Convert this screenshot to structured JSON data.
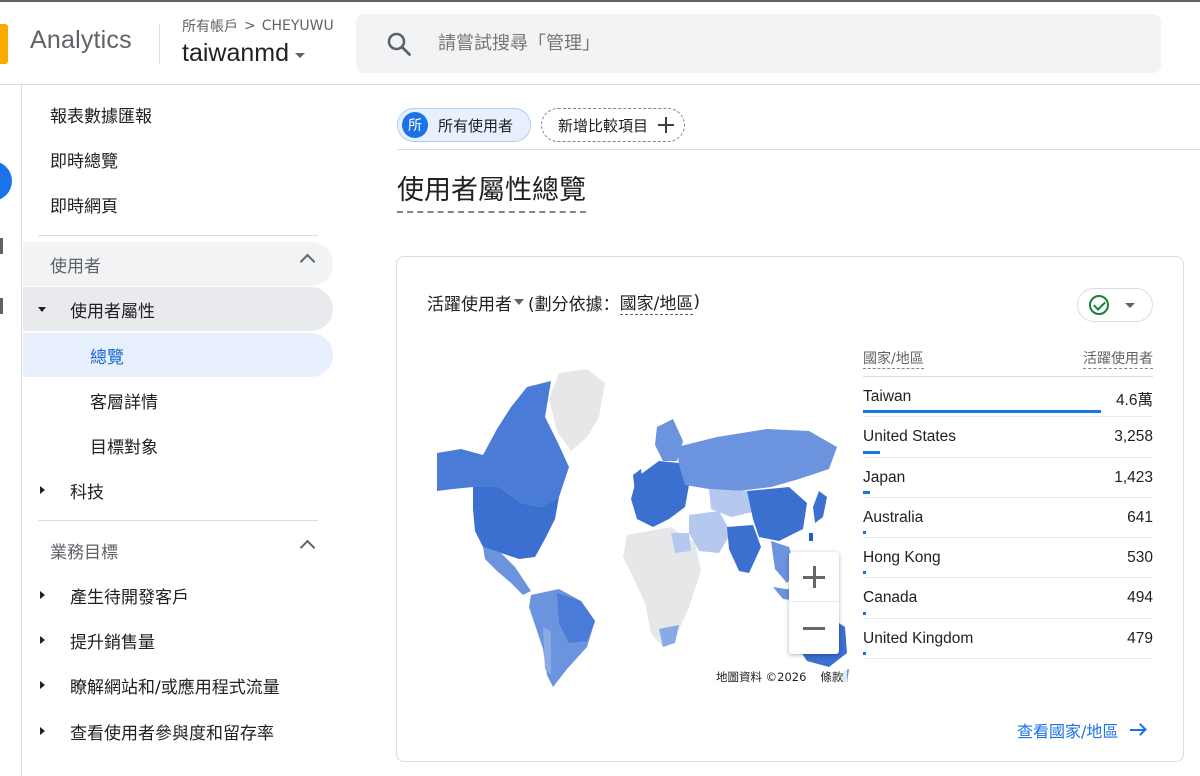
{
  "header": {
    "app_name": "Analytics",
    "breadcrumb_account": "所有帳戶",
    "breadcrumb_sep": ">",
    "breadcrumb_property": "CHEYUWU",
    "property_name": "taiwanmd",
    "search_placeholder": "請嘗試搜尋「管理」"
  },
  "sidebar": {
    "top_items": [
      "報表數據匯報",
      "即時總覽",
      "即時網頁"
    ],
    "section_users": "使用者",
    "user_attrs": "使用者屬性",
    "overview": "總覽",
    "audience_details": "客層詳情",
    "target_audience": "目標對象",
    "tech": "科技",
    "section_business": "業務目標",
    "business_items": [
      "產生待開發客戶",
      "提升銷售量",
      "瞭解網站和/或應用程式流量",
      "查看使用者參與度和留存率"
    ]
  },
  "main": {
    "chip_all_avatar": "所",
    "chip_all_label": "所有使用者",
    "chip_add_label": "新增比較項目",
    "page_title": "使用者屬性總覽"
  },
  "card": {
    "metric": "活躍使用者",
    "breakdown_prefix": "(劃分依據：",
    "breakdown_dim": "國家/地區",
    "breakdown_suffix": ")",
    "col_country": "國家/地區",
    "col_users": "活躍使用者",
    "rows": [
      {
        "country": "Taiwan",
        "value": "4.6萬",
        "share": 1.0
      },
      {
        "country": "United States",
        "value": "3,258",
        "share": 0.071
      },
      {
        "country": "Japan",
        "value": "1,423",
        "share": 0.031
      },
      {
        "country": "Australia",
        "value": "641",
        "share": 0.014
      },
      {
        "country": "Hong Kong",
        "value": "530",
        "share": 0.0115
      },
      {
        "country": "Canada",
        "value": "494",
        "share": 0.0107
      },
      {
        "country": "United Kingdom",
        "value": "479",
        "share": 0.0104
      }
    ],
    "map_credit": "地圖資料 ©2026",
    "map_terms": "條款",
    "view_link": "查看國家/地區"
  },
  "colors": {
    "accent": "#1a73e8",
    "map_dark": "#3b6fd0",
    "map_mid": "#6b93de",
    "map_light": "#b5c9ee",
    "map_none": "#e6e7e9"
  }
}
